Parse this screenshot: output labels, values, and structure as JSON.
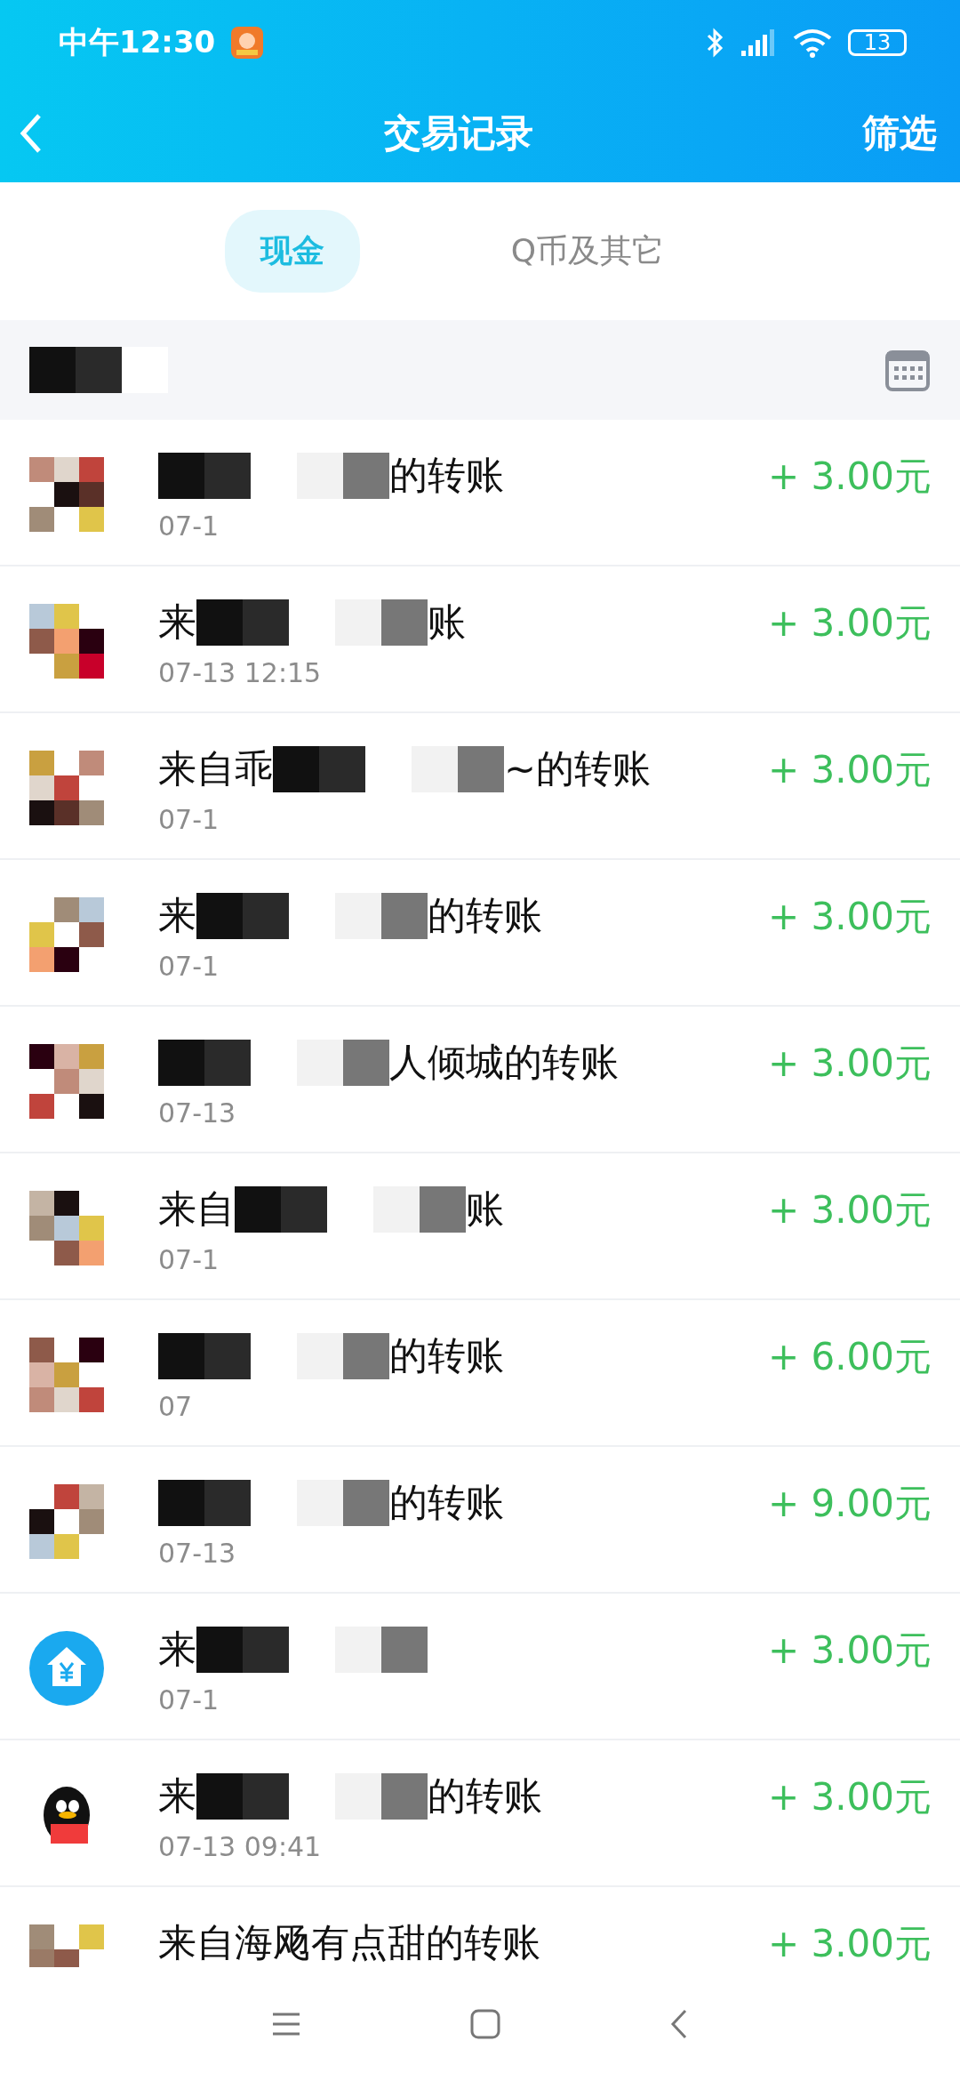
{
  "status_bar": {
    "time": "中午12:30",
    "battery": "13"
  },
  "header": {
    "title": "交易记录",
    "action": "筛选"
  },
  "tabs": [
    {
      "label": "现金",
      "selected": true
    },
    {
      "label": "Q币及其它",
      "selected": false
    }
  ],
  "records": [
    {
      "avatar": {
        "kind": "mosaic"
      },
      "title": [
        {
          "kind": "mosaic"
        },
        {
          "kind": "text",
          "text": "的转账"
        }
      ],
      "time": "07-1",
      "amount": "+ 3.00元"
    },
    {
      "avatar": {
        "kind": "mosaic"
      },
      "title": [
        {
          "kind": "text",
          "text": "来"
        },
        {
          "kind": "mosaic"
        },
        {
          "kind": "text",
          "text": "账"
        }
      ],
      "time": "07-13 12:15",
      "amount": "+ 3.00元"
    },
    {
      "avatar": {
        "kind": "mosaic"
      },
      "title": [
        {
          "kind": "text",
          "text": "来自乖"
        },
        {
          "kind": "mosaic"
        },
        {
          "kind": "text",
          "text": "~的转账"
        }
      ],
      "time": "07-1",
      "amount": "+ 3.00元"
    },
    {
      "avatar": {
        "kind": "mosaic"
      },
      "title": [
        {
          "kind": "text",
          "text": "来"
        },
        {
          "kind": "mosaic"
        },
        {
          "kind": "text",
          "text": "的转账"
        }
      ],
      "time": "07-1",
      "amount": "+ 3.00元"
    },
    {
      "avatar": {
        "kind": "mosaic"
      },
      "title": [
        {
          "kind": "mosaic"
        },
        {
          "kind": "text",
          "text": "人倾城的转账"
        }
      ],
      "time": "07-13",
      "amount": "+ 3.00元"
    },
    {
      "avatar": {
        "kind": "mosaic"
      },
      "title": [
        {
          "kind": "text",
          "text": "来自"
        },
        {
          "kind": "mosaic"
        },
        {
          "kind": "text",
          "text": "账"
        }
      ],
      "time": "07-1",
      "amount": "+ 3.00元"
    },
    {
      "avatar": {
        "kind": "mosaic"
      },
      "title": [
        {
          "kind": "mosaic"
        },
        {
          "kind": "text",
          "text": "的转账"
        }
      ],
      "time": "07",
      "amount": "+ 6.00元"
    },
    {
      "avatar": {
        "kind": "mosaic"
      },
      "title": [
        {
          "kind": "mosaic"
        },
        {
          "kind": "text",
          "text": "的转账"
        }
      ],
      "time": "07-13",
      "amount": "+ 9.00元"
    },
    {
      "avatar": {
        "kind": "house"
      },
      "title": [
        {
          "kind": "text",
          "text": "来"
        },
        {
          "kind": "mosaic"
        }
      ],
      "time": "07-1",
      "amount": "+ 3.00元"
    },
    {
      "avatar": {
        "kind": "penguin"
      },
      "title": [
        {
          "kind": "text",
          "text": "来"
        },
        {
          "kind": "mosaic"
        },
        {
          "kind": "text",
          "text": "的转账"
        }
      ],
      "time": "07-13 09:41",
      "amount": "+ 3.00元"
    },
    {
      "avatar": {
        "kind": "mosaic"
      },
      "title": [
        {
          "kind": "text",
          "text": "来自海飏有点甜的转账"
        }
      ],
      "amount": "+ 3.00元"
    }
  ]
}
